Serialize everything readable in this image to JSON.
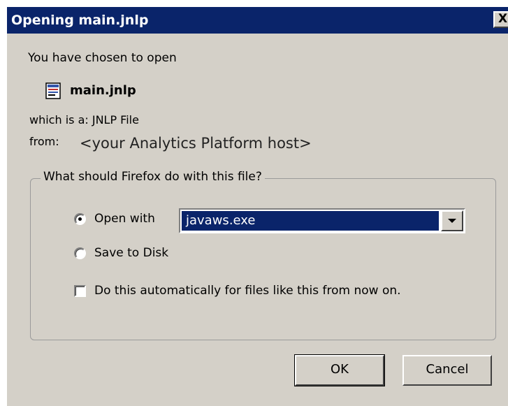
{
  "window": {
    "title": "Opening main.jnlp",
    "close_label": "X"
  },
  "dialog": {
    "intro": "You have chosen to open",
    "file": {
      "name": "main.jnlp",
      "icon": "jnlp-file-icon"
    },
    "which_is": "which is a:  JNLP File",
    "from_label": "from:",
    "from_value": "<your Analytics Platform host>"
  },
  "action_group": {
    "legend": "What should Firefox do with this file?",
    "open_with": {
      "label": "Open with",
      "selected": true,
      "application": "javaws.exe"
    },
    "save_to_disk": {
      "label": "Save to Disk",
      "selected": false
    },
    "auto": {
      "label": "Do this automatically for files like this from now on.",
      "checked": false
    }
  },
  "buttons": {
    "ok": "OK",
    "cancel": "Cancel"
  },
  "colors": {
    "titlebar": "#0a246a",
    "dialog_bg": "#d4d0c8",
    "selection": "#0a246a"
  }
}
